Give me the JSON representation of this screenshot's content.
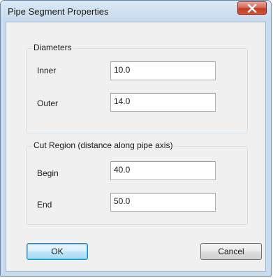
{
  "window": {
    "title": "Pipe Segment Properties",
    "close_icon": "close-icon"
  },
  "diameters": {
    "group_label": "Diameters",
    "inner_label": "Inner",
    "inner_value": "10.0",
    "outer_label": "Outer",
    "outer_value": "14.0"
  },
  "cut_region": {
    "group_label": "Cut Region (distance along pipe axis)",
    "begin_label": "Begin",
    "begin_value": "40.0",
    "end_label": "End",
    "end_value": "50.0"
  },
  "buttons": {
    "ok_label": "OK",
    "cancel_label": "Cancel"
  },
  "colors": {
    "frame": "#c9dcee",
    "close_button": "#c7432b",
    "default_button_border": "#3c7fb1"
  }
}
